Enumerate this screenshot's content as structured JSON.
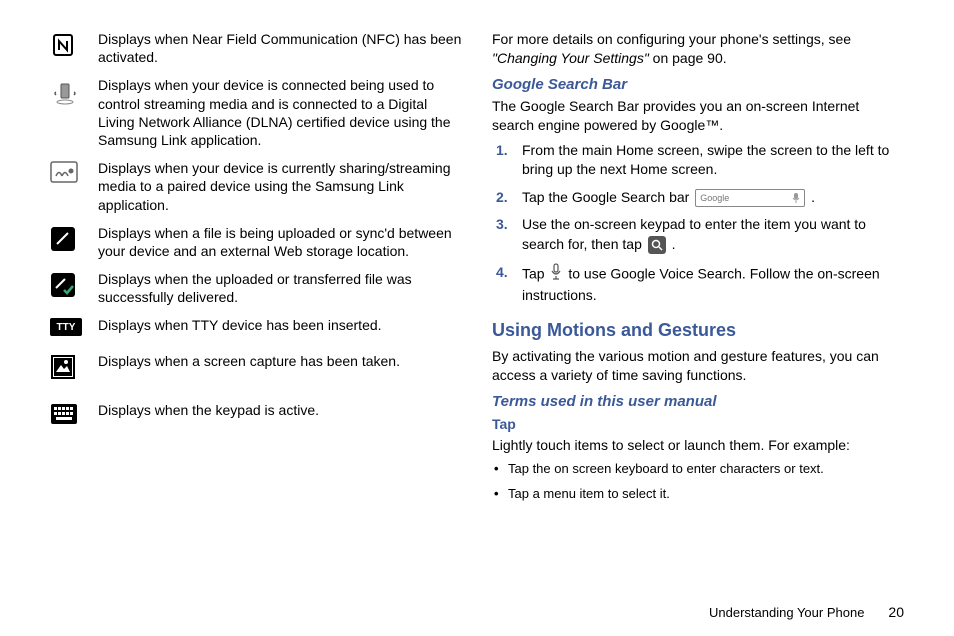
{
  "left_icons": [
    {
      "icon": "nfc",
      "desc": "Displays when Near Field Communication (NFC) has been activated."
    },
    {
      "icon": "dlna",
      "desc": "Displays when your device is connected being used to control streaming media and is connected to a Digital Living Network Alliance (DLNA) certified device using the Samsung Link application."
    },
    {
      "icon": "share",
      "desc": "Displays when your device is currently sharing/streaming media to a paired device using the Samsung Link application."
    },
    {
      "icon": "upload",
      "desc": "Displays when a file is being uploaded or sync'd between your device and an external Web storage location."
    },
    {
      "icon": "delivered",
      "desc": "Displays when the uploaded or transferred file was successfully delivered."
    },
    {
      "icon": "tty",
      "desc": "Displays when TTY device has been inserted."
    },
    {
      "icon": "screenshot",
      "desc": "Displays when a screen capture has been taken."
    },
    {
      "icon": "keypad",
      "desc": "Displays when the keypad is active."
    }
  ],
  "right": {
    "intro_prefix": "For more details on configuring your phone's settings, see ",
    "intro_quote": "\"Changing Your Settings\"",
    "intro_suffix": " on page 90.",
    "google_heading": "Google Search Bar",
    "google_body": "The Google Search Bar provides you an on-screen Internet search engine powered by Google™.",
    "steps": [
      "From the main Home screen, swipe the screen to the left to bring up the next Home screen.",
      "Tap the Google Search bar",
      "Use the on-screen keypad to enter the item you want to search for, then tap",
      "Tap|to use Google Voice Search. Follow the on-screen instructions."
    ],
    "motions_heading": "Using Motions and Gestures",
    "motions_body": "By activating the various motion and gesture features, you can access a variety of time saving functions.",
    "terms_heading": "Terms used in this user manual",
    "tap_heading": "Tap",
    "tap_body": "Lightly touch items to select or launch them. For example:",
    "tap_bullets": [
      "Tap the on screen keyboard to enter characters or text.",
      "Tap a menu item to select it."
    ]
  },
  "footer": {
    "section": "Understanding Your Phone",
    "page": "20"
  },
  "search_widget": {
    "placeholder": "Google"
  }
}
